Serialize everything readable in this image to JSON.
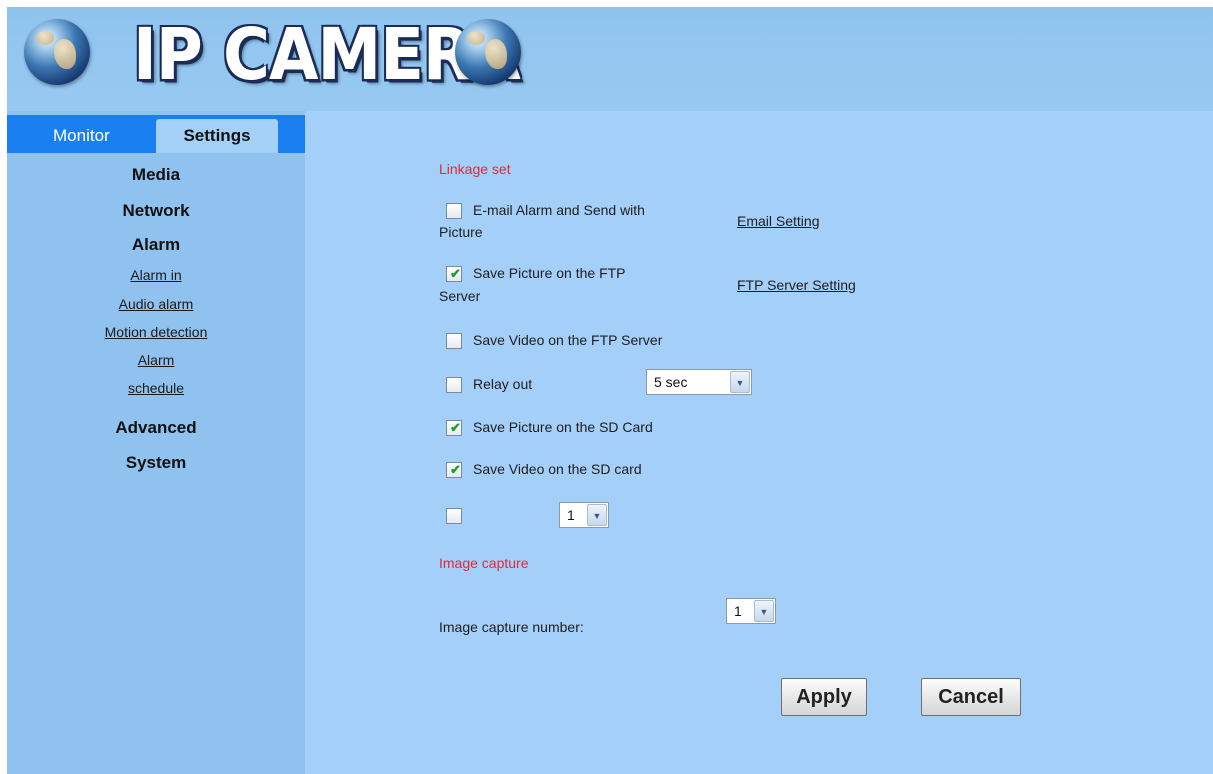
{
  "header": {
    "logo_text": "IP CAMERA"
  },
  "tabs": {
    "monitor": "Monitor",
    "settings": "Settings"
  },
  "sidebar": {
    "media": "Media",
    "network": "Network",
    "alarm": "Alarm",
    "alarm_in": "Alarm in",
    "audio_alarm": "Audio alarm",
    "motion_detection": "Motion detection",
    "alarm_sub": "Alarm",
    "schedule": "schedule",
    "advanced": "Advanced",
    "system": "System"
  },
  "linkage": {
    "title": "Linkage set",
    "email": {
      "label_line1": "E-mail Alarm and Send with",
      "label_line2": "Picture",
      "checked": false,
      "link": "Email Setting"
    },
    "ftp_picture": {
      "label_line1": "Save Picture on the FTP",
      "label_line2": "Server",
      "checked": true,
      "link": "FTP Server Setting"
    },
    "ftp_video": {
      "label": "Save Video on the FTP Server",
      "checked": false
    },
    "relay": {
      "label": "Relay out",
      "checked": false,
      "select_value": "5 sec"
    },
    "sd_picture": {
      "label": "Save Picture on the SD Card",
      "checked": true
    },
    "sd_video": {
      "label": "Save Video on the SD card",
      "checked": true
    },
    "extra": {
      "checked": false,
      "select_value": "1"
    }
  },
  "image_capture": {
    "title": "Image capture",
    "number_label": "Image capture number:",
    "number_value": "1"
  },
  "buttons": {
    "apply": "Apply",
    "cancel": "Cancel"
  },
  "colors": {
    "header_bg": "#8fc4ee",
    "sidebar_bg": "#8fc2ee",
    "tabbar_bg": "#1a80f2",
    "main_bg": "#a4cff8",
    "section_title": "#e8263a",
    "checkmark": "#1d9d2b"
  }
}
